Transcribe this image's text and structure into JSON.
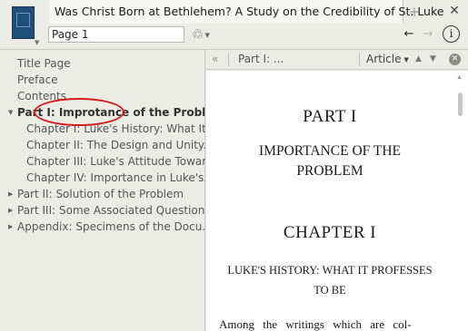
{
  "window": {
    "tab_title": "Was Christ Born at Bethlehem? A Study on the Credibility of St. Luke",
    "new_tab_symbol": "+",
    "close_symbol": "✕"
  },
  "toolbar": {
    "page_value": "Page 1",
    "annotation_icon": "♲",
    "annotation_dropdown": "▼",
    "back_symbol": "←",
    "forward_symbol": "→",
    "info_symbol": "i"
  },
  "toc": {
    "items": [
      {
        "label": "Title Page",
        "arrow": ""
      },
      {
        "label": "Preface",
        "arrow": ""
      },
      {
        "label": "Contents",
        "arrow": ""
      },
      {
        "label": "Part I: Improtance of the Problem",
        "arrow": "▼"
      },
      {
        "label": "Chapter I: Luke's History: What It...",
        "arrow": ""
      },
      {
        "label": "Chapter II: The Design and Unity...",
        "arrow": ""
      },
      {
        "label": "Chapter III: Luke's Attitude Towar...",
        "arrow": ""
      },
      {
        "label": "Chapter IV: Importance in Luke's...",
        "arrow": ""
      },
      {
        "label": "Part II: Solution of the Problem",
        "arrow": "▶"
      },
      {
        "label": "Part III: Some Associated Questions",
        "arrow": "▶"
      },
      {
        "label": "Appendix: Specimens of the Docu...",
        "arrow": "▶"
      }
    ]
  },
  "reader_header": {
    "collapse_symbol": "«",
    "section": "Part I: ...",
    "view_mode": "Article",
    "view_dropdown": "▼",
    "up_symbol": "▲",
    "down_symbol": "▼",
    "close_symbol": "✕"
  },
  "content": {
    "part_heading": "PART I",
    "part_title": "IMPORTANCE OF THE PROBLEM",
    "chapter_heading": "CHAPTER I",
    "chapter_title": "LUKE'S HISTORY: WHAT IT PROFESSES TO BE",
    "body_start": "Among the writings which are col-",
    "scroll_up": "▲"
  },
  "colors": {
    "highlight_ellipse": "#d61b1b",
    "cover": "#1f4e7a"
  }
}
